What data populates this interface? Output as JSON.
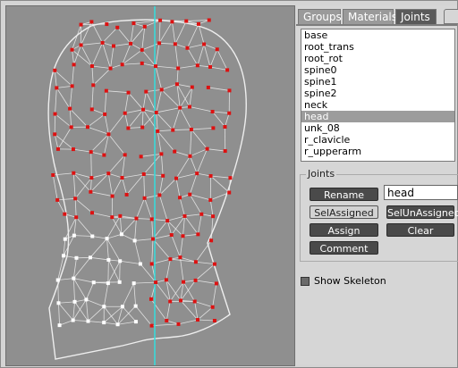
{
  "tabs": [
    "Groups",
    "Materials",
    "Joints"
  ],
  "active_tab": "Joints",
  "joints": {
    "items": [
      "base",
      "root_trans",
      "root_rot",
      "spine0",
      "spine1",
      "spine2",
      "neck",
      "head",
      "unk_08",
      "r_clavicle",
      "r_upperarm"
    ],
    "selected": "head"
  },
  "joints_panel": {
    "legend": "Joints",
    "rename_label": "Rename",
    "name_value": "head",
    "selassigned_label": "SelAssigned",
    "selunassigned_label": "SelUnAssigned",
    "assign_label": "Assign",
    "clear_label": "Clear",
    "comment_label": "Comment"
  },
  "show_skeleton_label": "Show Skeleton",
  "colors": {
    "viewport_bg": "#8f8f8f",
    "wire": "#eeeeee",
    "assigned_vertex": "#dd1111",
    "unassigned_vertex": "#ffffff",
    "axis": "#33dddd"
  }
}
